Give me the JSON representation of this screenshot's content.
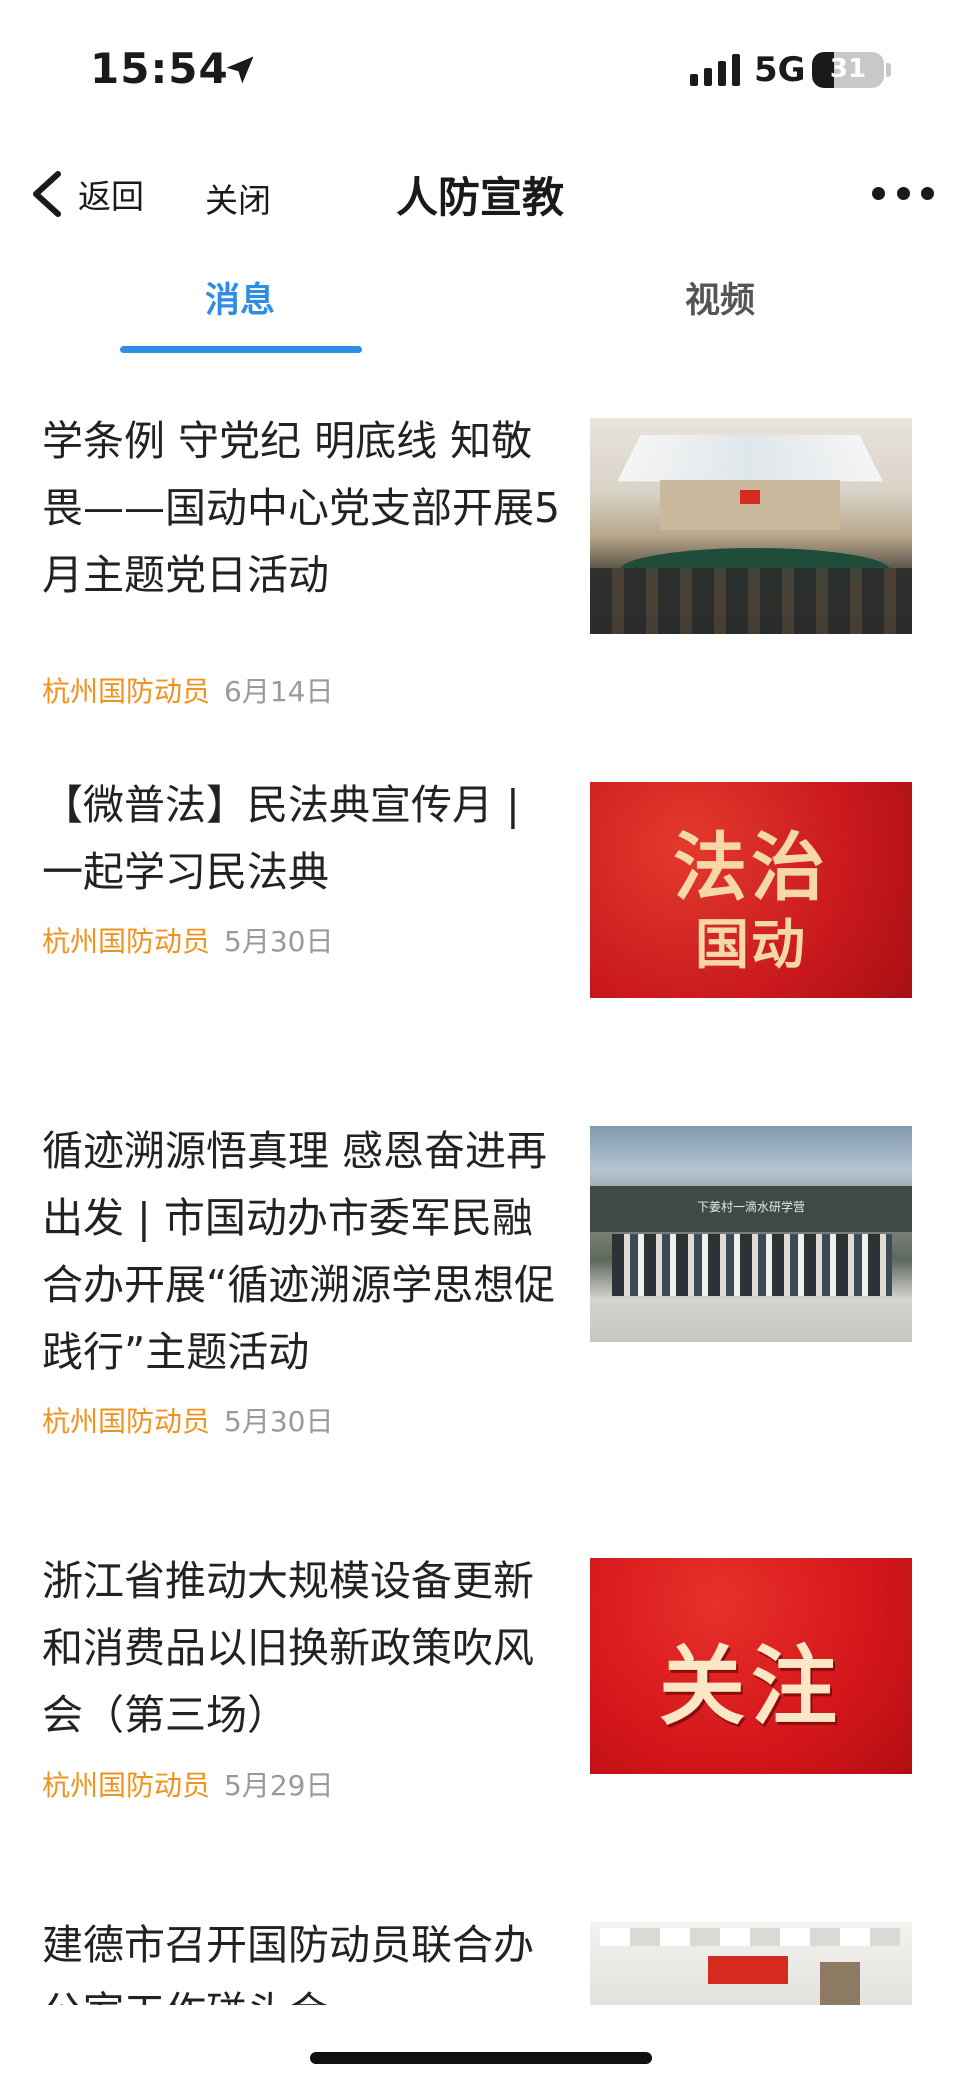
{
  "status_bar": {
    "time": "15:54",
    "network": "5G",
    "battery_level": "31"
  },
  "nav": {
    "back_label": "返回",
    "close_label": "关闭",
    "title": "人防宣教"
  },
  "tabs": [
    {
      "label": "消息",
      "active": true
    },
    {
      "label": "视频",
      "active": false
    }
  ],
  "articles": [
    {
      "title": "学条例 守党纪 明底线 知敬畏——国动中心党支部开展5月主题党日活动",
      "source": "杭州国防动员",
      "date": "6月14日"
    },
    {
      "title": "【微普法】民法典宣传月 | 一起学习民法典",
      "source": "杭州国防动员",
      "date": "5月30日",
      "thumb_text_1": "法治",
      "thumb_text_2": "国动"
    },
    {
      "title": "循迹溯源悟真理 感恩奋进再出发 | 市国动办市委军民融合办开展“循迹溯源学思想促践行”主题活动",
      "source": "杭州国防动员",
      "date": "5月30日",
      "thumb_sign": "下姜村一滴水研学营"
    },
    {
      "title": "浙江省推动大规模设备更新和消费品以旧换新政策吹风会（第三场）",
      "source": "杭州国防动员",
      "date": "5月29日",
      "thumb_text": "关注"
    },
    {
      "title": "建德市召开国防动员联合办公室工作碰头会"
    }
  ],
  "colors": {
    "accent_blue": "#2f8de4",
    "source_orange": "#f0921e",
    "date_gray": "#9a9a9a"
  }
}
